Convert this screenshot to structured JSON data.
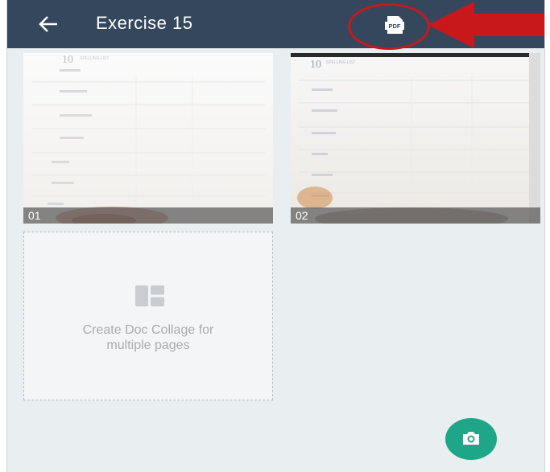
{
  "appbar": {
    "title": "Exercise 15",
    "back_icon": "arrow-left-icon",
    "pdf_icon": "pdf-icon",
    "pdf_icon_text": "PDF",
    "color": "#34475c"
  },
  "annotation": {
    "circle_color": "#c8181c",
    "arrow_color": "#c8181c"
  },
  "pages": [
    {
      "label": "01",
      "header": "10",
      "header_sub": "SPELLING LIST"
    },
    {
      "label": "02",
      "header": "10",
      "header_sub": "SPELLING LIST"
    }
  ],
  "collage": {
    "icon": "collage-icon",
    "text_line1": "Create Doc Collage for",
    "text_line2": "multiple pages"
  },
  "fab": {
    "icon": "camera-icon",
    "color": "#1fa587"
  }
}
